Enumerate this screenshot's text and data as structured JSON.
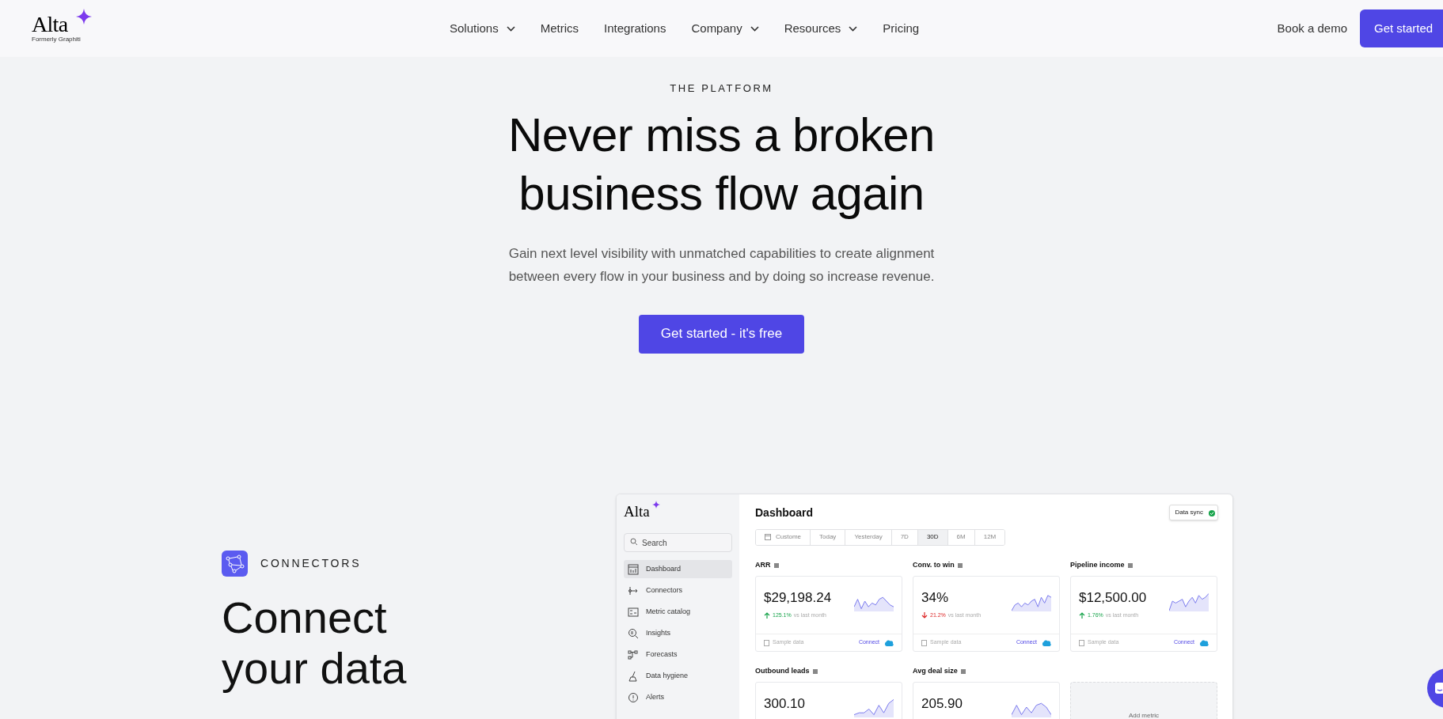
{
  "header": {
    "logo": {
      "text": "Alta",
      "tagline": "Formerly Graphiti"
    },
    "nav": [
      {
        "label": "Solutions",
        "dropdown": true
      },
      {
        "label": "Metrics",
        "dropdown": false
      },
      {
        "label": "Integrations",
        "dropdown": false
      },
      {
        "label": "Company",
        "dropdown": true
      },
      {
        "label": "Resources",
        "dropdown": true
      },
      {
        "label": "Pricing",
        "dropdown": false
      }
    ],
    "demo_link": "Book a demo",
    "cta": "Get started"
  },
  "hero": {
    "eyebrow": "THE PLATFORM",
    "title_lines": [
      "Never miss a broken",
      "business flow again"
    ],
    "subtitle_lines": [
      "Gain next level visibility with unmatched capabilities to create alignment",
      "between every flow in your business and by doing so increase revenue."
    ],
    "cta": "Get started - it's free"
  },
  "connectors": {
    "eyebrow": "CONNECTORS",
    "title_lines": [
      "Connect",
      "your data"
    ]
  },
  "dashboard": {
    "logo": "Alta",
    "search_placeholder": "Search",
    "nav": [
      {
        "label": "Dashboard",
        "kind": "dashboard",
        "selected": true
      },
      {
        "label": "Connectors",
        "kind": "connectors",
        "selected": false
      },
      {
        "label": "Metric catalog",
        "kind": "catalog",
        "selected": false
      },
      {
        "label": "Insights",
        "kind": "insights",
        "selected": false
      },
      {
        "label": "Forecasts",
        "kind": "forecasts",
        "selected": false
      },
      {
        "label": "Data hygiene",
        "kind": "hygiene",
        "selected": false
      },
      {
        "label": "Alerts",
        "kind": "alerts",
        "selected": false
      }
    ],
    "title": "Dashboard",
    "sync_button": "Data sync",
    "periods": [
      {
        "label": "Custome",
        "selected": false
      },
      {
        "label": "Today",
        "selected": false
      },
      {
        "label": "Yesterday",
        "selected": false
      },
      {
        "label": "7D",
        "selected": false
      },
      {
        "label": "30D",
        "selected": true
      },
      {
        "label": "6M",
        "selected": false
      },
      {
        "label": "12M",
        "selected": false
      }
    ],
    "metrics": [
      {
        "title": "ARR",
        "value": "$29,198.24",
        "kind": "up",
        "change": "125.1%",
        "compare": "vs last month",
        "source": "Sample data",
        "action": "Connect"
      },
      {
        "title": "Conv. to win",
        "value": "34%",
        "kind": "down",
        "change": "21.2%",
        "compare": "vs last month",
        "source": "Sample data",
        "action": "Connect"
      },
      {
        "title": "Pipeline income",
        "value": "$12,500.00",
        "kind": "up",
        "change": "1.76%",
        "compare": "vs last month",
        "source": "Sample data",
        "action": "Connect"
      },
      {
        "title": "Outbound leads",
        "value": "300.10"
      },
      {
        "title": "Avg deal size",
        "value": "205.90"
      }
    ],
    "add_metric": "Add metric"
  }
}
